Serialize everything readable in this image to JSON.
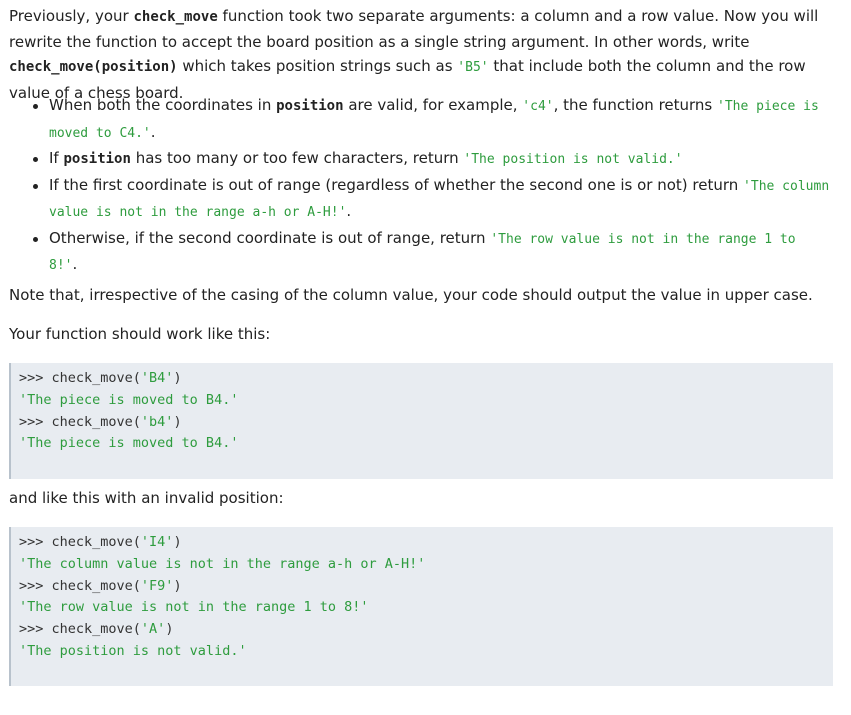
{
  "intro": {
    "t1": "Previously, your ",
    "c1": "check_move",
    "t2": " function took two separate arguments: a column and a row value. Now you will rewrite the function to accept the board position as a single string argument. In other words, write ",
    "c2": "check_move(position)",
    "t3": " which takes position strings such as ",
    "c3": "'B5'",
    "t4": " that include both the column and the row value of a chess board."
  },
  "bullets": [
    {
      "t1": "When both the coordinates in ",
      "c1": "position",
      "t2": " are valid, for example, ",
      "g1": "'c4'",
      "t3": ", the function returns ",
      "g2": "'The piece is moved to C4.'",
      "t4": "."
    },
    {
      "t1": "If ",
      "c1": "position",
      "t2": " has too many or too few characters, return ",
      "g1": "'The position is not valid.'"
    },
    {
      "t1": "If the first coordinate is out of range (regardless of whether the second one is or not) return ",
      "g1": "'The column value is not in the range a-h or A-H!'",
      "t2": "."
    },
    {
      "t1": "Otherwise, if the second coordinate is out of range, return ",
      "g1": "'The row value is not in the range 1 to 8!'",
      "t2": "."
    }
  ],
  "note": "Note that, irrespective of the casing of the column value, your code should output the value in upper case.",
  "work_like": "Your function should work like this:",
  "code1": [
    {
      "prompt": ">>> check_move(",
      "arg": "'B4'",
      "close": ")"
    },
    {
      "output": "'The piece is moved to B4.'"
    },
    {
      "prompt": ">>> check_move(",
      "arg": "'b4'",
      "close": ")"
    },
    {
      "output": "'The piece is moved to B4.'"
    }
  ],
  "invalid_intro": "and like this with an invalid position:",
  "code2": [
    {
      "prompt": ">>> check_move(",
      "arg": "'I4'",
      "close": ")"
    },
    {
      "output": "'The column value is not in the range a-h or A-H!'"
    },
    {
      "prompt": ">>> check_move(",
      "arg": "'F9'",
      "close": ")"
    },
    {
      "output": "'The row value is not in the range 1 to 8!'"
    },
    {
      "prompt": ">>> check_move(",
      "arg": "'A'",
      "close": ")"
    },
    {
      "output": "'The position is not valid.'"
    }
  ]
}
